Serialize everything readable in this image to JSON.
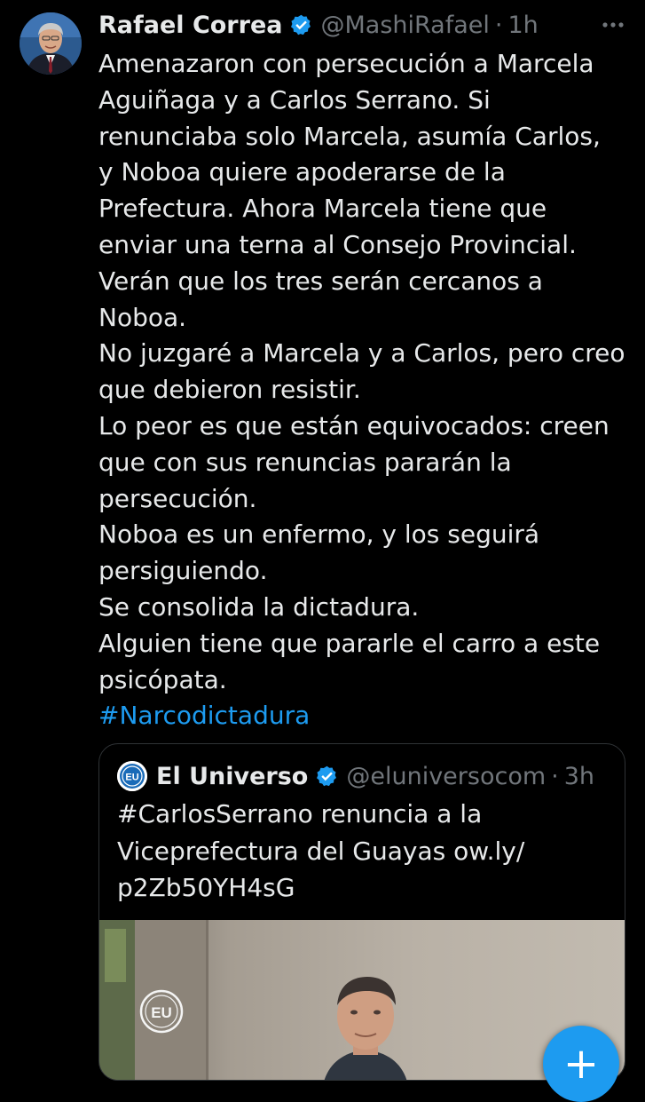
{
  "tweet": {
    "author": {
      "name": "Rafael Correa",
      "handle": "@MashiRafael",
      "separator": "·",
      "time": "1h",
      "verified": true
    },
    "lines": [
      "Amenazaron con persecución a Marcela",
      "Aguiñaga y a Carlos Serrano. Si",
      "renunciaba solo Marcela, asumía Carlos,",
      "y Noboa quiere apoderarse de la",
      "Prefectura. Ahora Marcela tiene que",
      "enviar una terna al Consejo Provincial.",
      "Verán que los tres serán cercanos a",
      "Noboa.",
      "No juzgaré a Marcela y a Carlos, pero creo",
      "que debieron resistir.",
      "Lo peor es que están equivocados: creen",
      "que con sus renuncias pararán la",
      "persecución.",
      "Noboa es un enfermo, y los seguirá",
      "persiguiendo.",
      "Se consolida la dictadura.",
      "Alguien  tiene que pararle el carro a este",
      "psicópata."
    ],
    "hashtag": "#Narcodictadura"
  },
  "quoted": {
    "author": {
      "avatar_text": "EU",
      "name": "El Universo",
      "handle": "@eluniversocom",
      "separator": "·",
      "time": "3h",
      "verified": true
    },
    "lines": [
      "#CarlosSerrano renuncia a la",
      "Viceprefectura del Guayas  ow.ly/",
      "p2Zb50YH4sG"
    ],
    "image_watermark": "EU"
  },
  "compose_button": {
    "icon": "plus-icon",
    "label": "+"
  },
  "colors": {
    "background": "#000000",
    "text": "#e7e9ea",
    "secondary_text": "#71767b",
    "accent": "#1d9bf0",
    "border": "#2f3336"
  }
}
